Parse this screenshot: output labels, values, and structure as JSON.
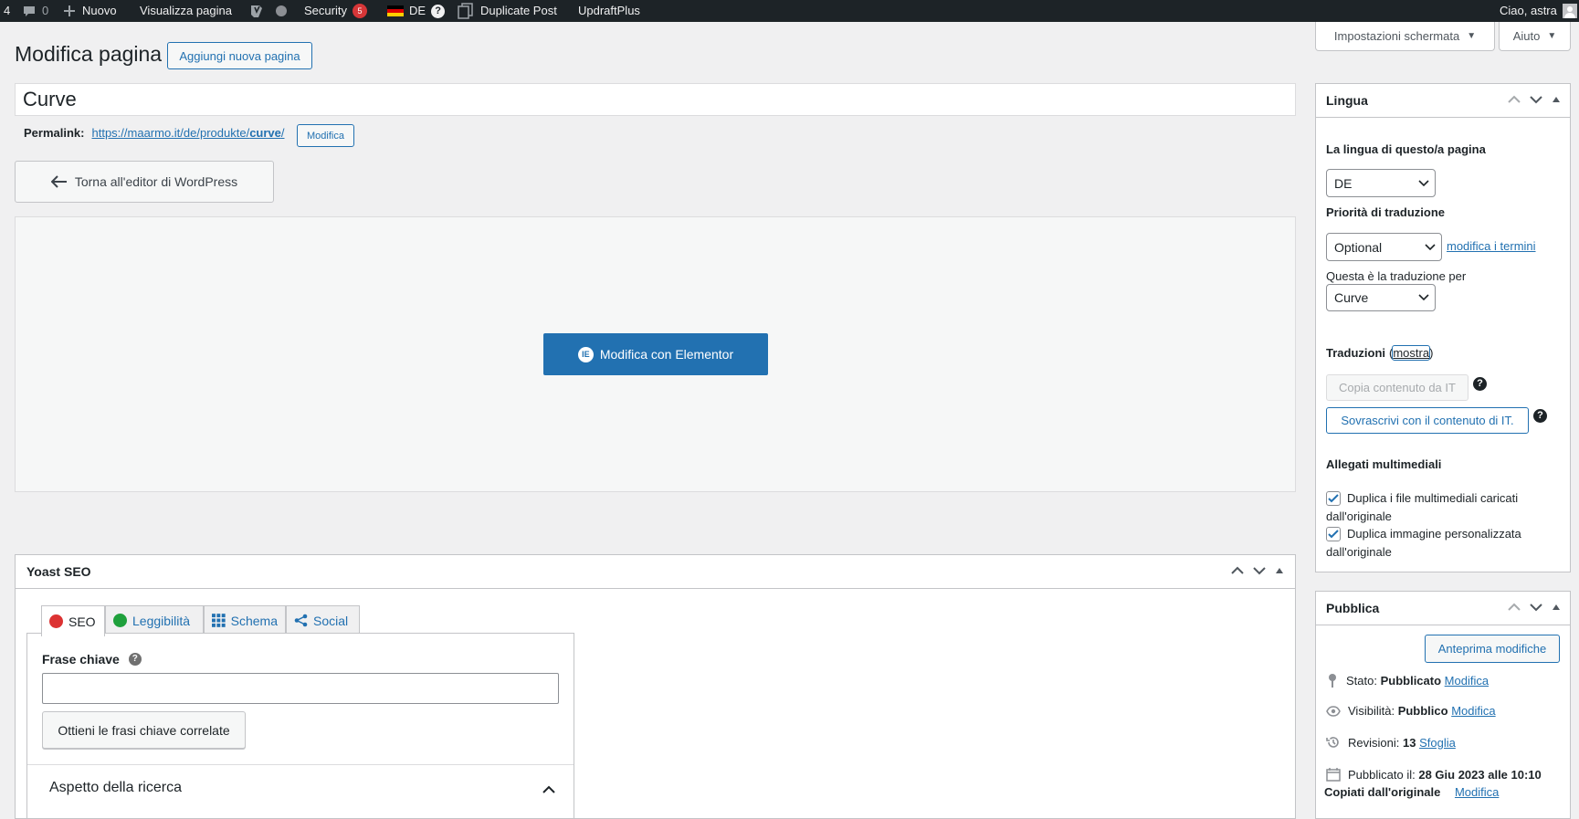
{
  "adminbar": {
    "updates_count": "4",
    "comments_count": "0",
    "new_label": "Nuovo",
    "view_page": "Visualizza pagina",
    "security": "Security",
    "security_badge": "5",
    "language": "DE",
    "language_help": "?",
    "duplicate_post": "Duplicate Post",
    "updraftplus": "UpdraftPlus",
    "greeting": "Ciao, astra"
  },
  "screen_options": "Impostazioni schermata",
  "help": "Aiuto",
  "page": {
    "heading": "Modifica pagina",
    "add_new": "Aggiungi nuova pagina",
    "title_value": "Curve",
    "permalink_label": "Permalink:",
    "permalink_base": "https://maarmo.it/de/produkte/",
    "permalink_slug": "curve",
    "permalink_end": "/",
    "permalink_edit": "Modifica",
    "back_editor": "Torna all'editor di WordPress",
    "elementor_button": "Modifica con Elementor"
  },
  "yoast": {
    "title": "Yoast SEO",
    "tabs": {
      "seo": "SEO",
      "readability": "Leggibilità",
      "schema": "Schema",
      "social": "Social"
    },
    "keyphrase_label": "Frase chiave",
    "keyphrase_value": "",
    "related_button": "Ottieni le frasi chiave correlate",
    "search_appearance": "Aspetto della ricerca"
  },
  "lingua": {
    "title": "Lingua",
    "language_label": "La lingua di questo/a pagina",
    "language_value": "DE",
    "priority_label": "Priorità di traduzione",
    "priority_value": "Optional",
    "edit_terms": "modifica i termini",
    "translation_of_label": "Questa è la traduzione per",
    "translation_of_value": "Curve",
    "translations_label": "Traduzioni",
    "show_link": "mostra",
    "copy_button": "Copia contenuto da IT",
    "overwrite_button": "Sovrascrivi con il contenuto di IT.",
    "help": "?",
    "media_label": "Allegati multimediali",
    "dup_media_line1": "Duplica i file multimediali caricati",
    "dup_media_line2": "dall'originale",
    "dup_image_line1": "Duplica immagine personalizzata",
    "dup_image_line2": "dall'originale"
  },
  "pubblica": {
    "title": "Pubblica",
    "preview_button": "Anteprima modifiche",
    "status_label": "Stato:",
    "status_value": "Pubblicato",
    "status_edit": "Modifica",
    "visibility_label": "Visibilità:",
    "visibility_value": "Pubblico",
    "visibility_edit": "Modifica",
    "revisions_label": "Revisioni:",
    "revisions_value": "13",
    "revisions_browse": "Sfoglia",
    "published_label": "Pubblicato il:",
    "published_value": "28 Giu 2023 alle 10:10",
    "copied_label": "Copiati dall'originale",
    "copied_edit": "Modifica"
  }
}
